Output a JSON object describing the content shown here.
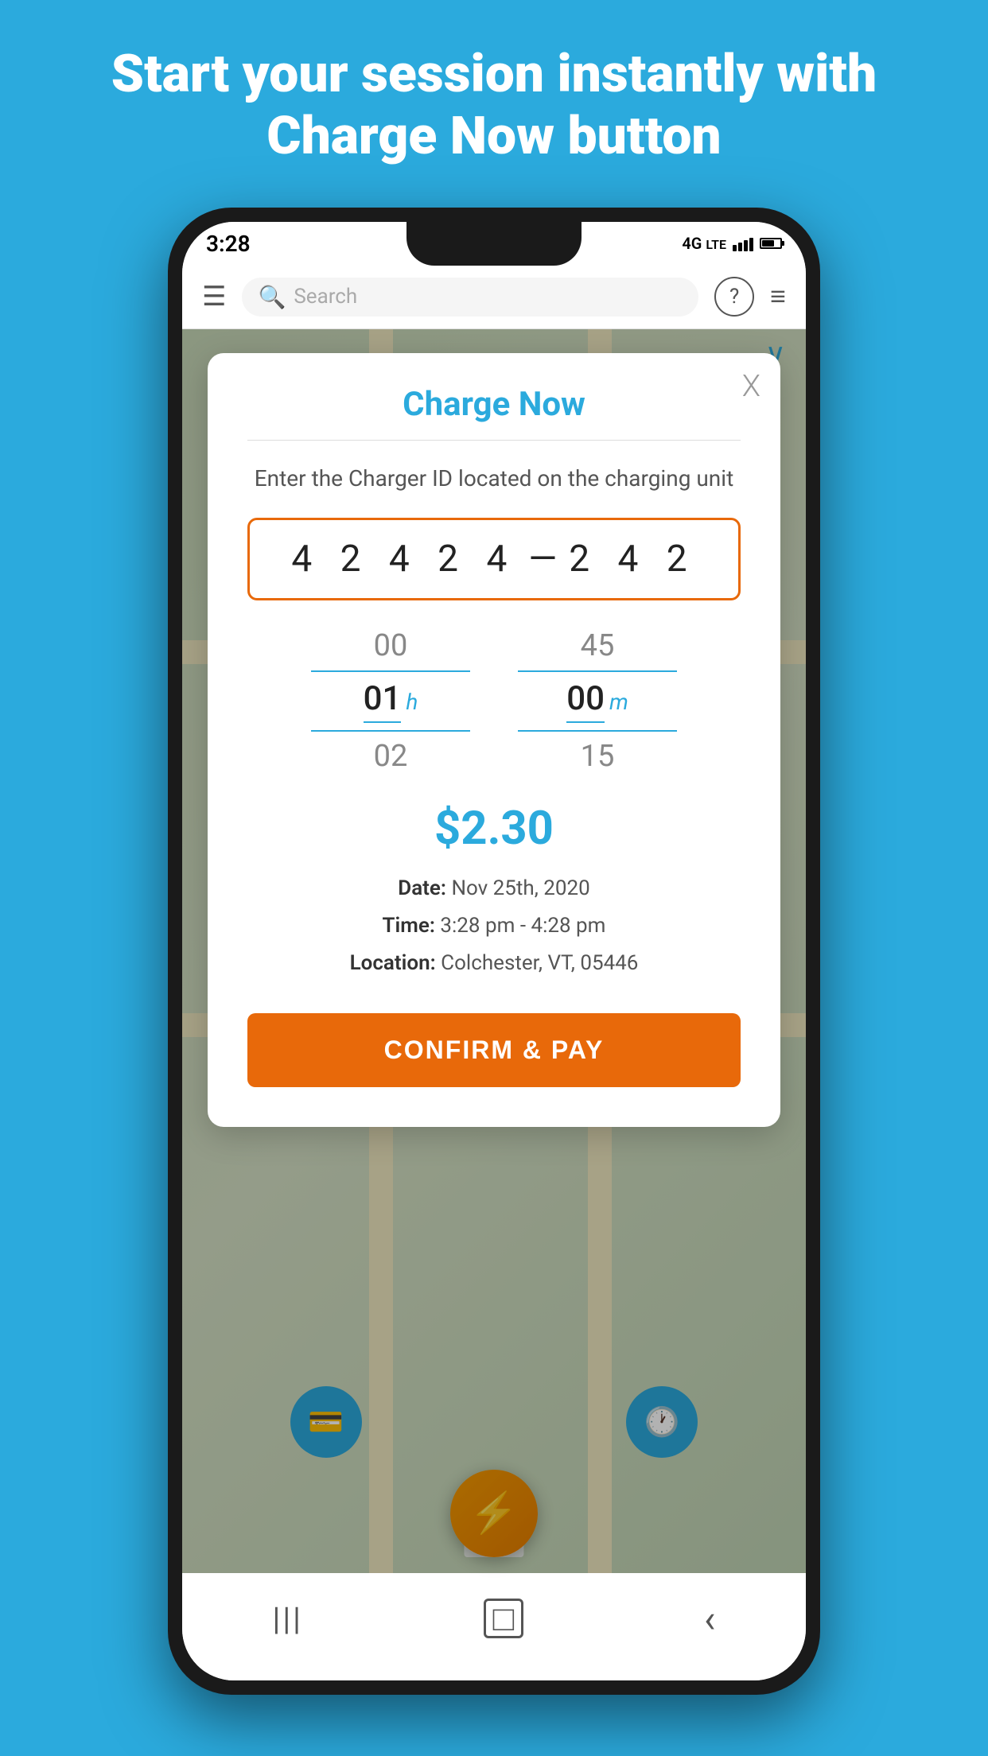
{
  "page": {
    "background_color": "#2BAADD",
    "header": {
      "text": "Start your session instantly with Charge Now button"
    }
  },
  "status_bar": {
    "time": "3:28",
    "network": "4G",
    "signal": "●●●●",
    "battery": "75%"
  },
  "toolbar": {
    "search_placeholder": "Search",
    "help_icon": "?",
    "filter_icon": "≡"
  },
  "modal": {
    "title": "Charge Now",
    "subtitle": "Enter the Charger ID located on the charging unit",
    "close_label": "X",
    "charger_id_part1": "4 2 4 2 4",
    "charger_id_dash": "—",
    "charger_id_part2": "2 4 2",
    "time_picker": {
      "hours_above": "00",
      "hours_active": "01",
      "hours_unit": "h",
      "hours_below": "02",
      "minutes_above": "45",
      "minutes_active": "00",
      "minutes_unit": "m",
      "minutes_below": "15"
    },
    "price": "$2.30",
    "session_info": {
      "date_label": "Date:",
      "date_value": "Nov 25th, 2020",
      "time_label": "Time:",
      "time_value": "3:28 pm - 4:28 pm",
      "location_label": "Location:",
      "location_value": "Colchester, VT, 05446"
    },
    "confirm_button": "CONFIRM & PAY"
  },
  "bottom_nav": {
    "items": [
      {
        "icon": "|||",
        "label": "recent"
      },
      {
        "icon": "□",
        "label": "home"
      },
      {
        "icon": "‹",
        "label": "back"
      }
    ]
  }
}
